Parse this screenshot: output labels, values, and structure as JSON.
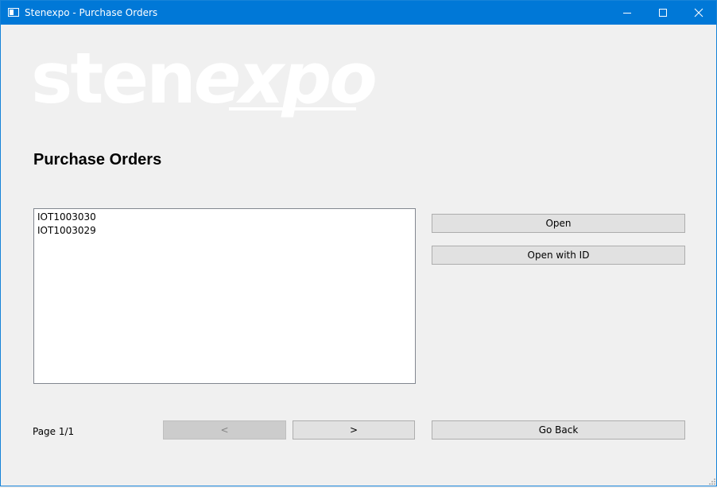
{
  "window": {
    "title": "Stenexpo - Purchase Orders",
    "accent_color": "#0078d7",
    "controls": [
      "minimize-icon",
      "maximize-icon",
      "close-icon"
    ]
  },
  "logo": {
    "text_plain": "sten",
    "text_italic": "expo"
  },
  "heading": "Purchase Orders",
  "orders": [
    "IOT1003030",
    "IOT1003029"
  ],
  "actions": {
    "open": "Open",
    "open_with_id": "Open with ID",
    "go_back": "Go Back"
  },
  "pagination": {
    "label": "Page 1/1",
    "prev": "<",
    "next": ">"
  }
}
